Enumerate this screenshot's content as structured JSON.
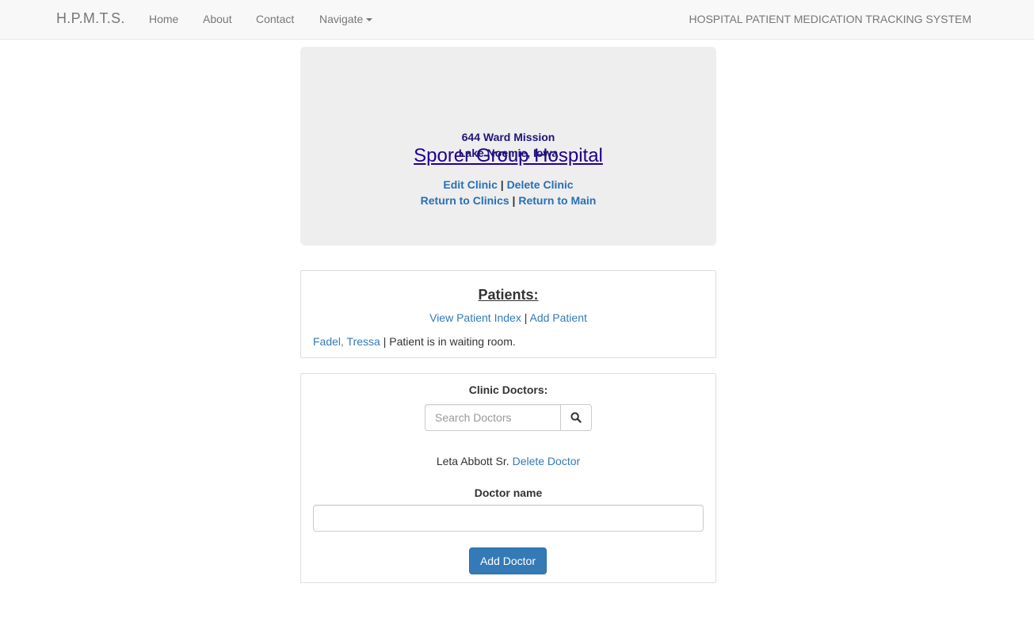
{
  "navbar": {
    "brand": "H.P.M.T.S.",
    "links": [
      "Home",
      "About",
      "Contact"
    ],
    "navigate_label": "Navigate",
    "system_title": "HOSPITAL PATIENT MEDICATION TRACKING SYSTEM"
  },
  "clinic": {
    "name": "Sporer Group Hospital",
    "address_line1": "644 Ward Mission",
    "address_line2": "Lake Noemie, Iowa",
    "edit_label": "Edit Clinic",
    "delete_label": "Delete Clinic",
    "return_clinics_label": "Return to Clinics",
    "return_main_label": "Return to Main",
    "separator": "|"
  },
  "patients": {
    "title": "Patients:",
    "view_index_label": "View Patient Index",
    "add_label": "Add Patient",
    "list": [
      {
        "name": "Fadel, Tressa",
        "status": "Patient is in waiting room."
      }
    ]
  },
  "doctors": {
    "title": "Clinic Doctors:",
    "search_placeholder": "Search Doctors",
    "list": [
      {
        "name": "Leta Abbott Sr.",
        "delete_label": "Delete Doctor"
      }
    ],
    "form_label": "Doctor name",
    "name_value": "",
    "add_button_label": "Add Doctor"
  },
  "colors": {
    "link": "#337ab7",
    "primary_button": "#337ab7",
    "jumbotron_bg": "#eeeeee",
    "navbar_bg": "#f8f8f8"
  }
}
